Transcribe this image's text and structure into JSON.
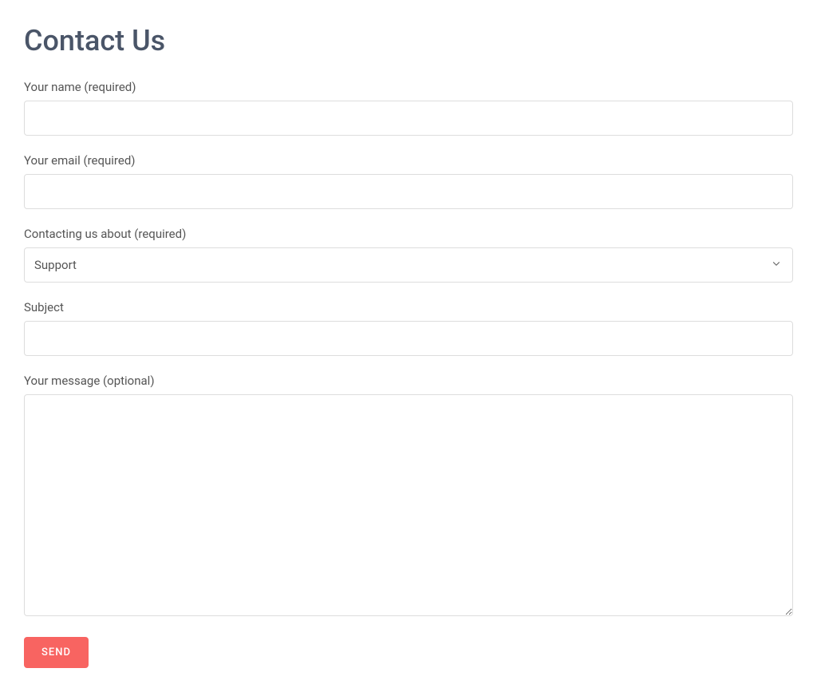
{
  "page": {
    "title": "Contact Us"
  },
  "form": {
    "fields": {
      "name": {
        "label": "Your name (required)",
        "value": ""
      },
      "email": {
        "label": "Your email (required)",
        "value": ""
      },
      "topic": {
        "label": "Contacting us about (required)",
        "selected": "Support"
      },
      "subject": {
        "label": "Subject",
        "value": ""
      },
      "message": {
        "label": "Your message (optional)",
        "value": ""
      }
    },
    "submit_label": "SEND"
  }
}
